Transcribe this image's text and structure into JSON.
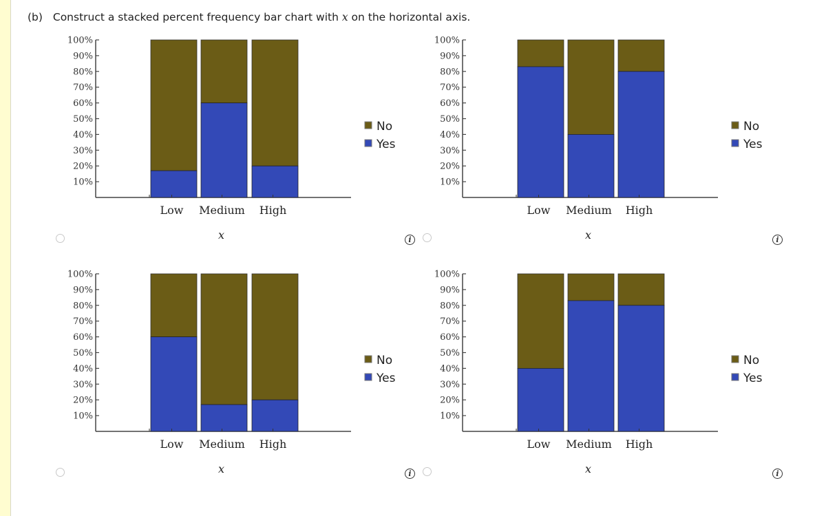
{
  "question": {
    "part": "(b)",
    "text_before": "Construct a stacked percent frequency bar chart with ",
    "variable": "x",
    "text_after": " on the horizontal axis."
  },
  "colors": {
    "No": "#6b5c16",
    "Yes": "#3349b7"
  },
  "options": [
    {
      "id": "option-a",
      "info_icon": "info-icon",
      "radio": "radio-button"
    },
    {
      "id": "option-b",
      "info_icon": "info-icon",
      "radio": "radio-button"
    },
    {
      "id": "option-c",
      "info_icon": "info-icon",
      "radio": "radio-button"
    },
    {
      "id": "option-d",
      "info_icon": "info-icon",
      "radio": "radio-button"
    }
  ],
  "info_glyph": "i",
  "chart_data": [
    {
      "type": "bar",
      "stacked": true,
      "categories": [
        "Low",
        "Medium",
        "High"
      ],
      "series": [
        {
          "name": "Yes",
          "values": [
            17,
            60,
            20
          ]
        },
        {
          "name": "No",
          "values": [
            83,
            40,
            80
          ]
        }
      ],
      "xlabel": "x",
      "ylabel": "",
      "yticks": [
        "10%",
        "20%",
        "30%",
        "40%",
        "50%",
        "60%",
        "70%",
        "80%",
        "90%",
        "100%"
      ],
      "ylim": [
        0,
        100
      ],
      "legend": [
        "No",
        "Yes"
      ],
      "legend_position": "right",
      "grid": false
    },
    {
      "type": "bar",
      "stacked": true,
      "categories": [
        "Low",
        "Medium",
        "High"
      ],
      "series": [
        {
          "name": "Yes",
          "values": [
            83,
            40,
            80
          ]
        },
        {
          "name": "No",
          "values": [
            17,
            60,
            20
          ]
        }
      ],
      "xlabel": "x",
      "ylabel": "",
      "yticks": [
        "10%",
        "20%",
        "30%",
        "40%",
        "50%",
        "60%",
        "70%",
        "80%",
        "90%",
        "100%"
      ],
      "ylim": [
        0,
        100
      ],
      "legend": [
        "No",
        "Yes"
      ],
      "legend_position": "right",
      "grid": false
    },
    {
      "type": "bar",
      "stacked": true,
      "categories": [
        "Low",
        "Medium",
        "High"
      ],
      "series": [
        {
          "name": "Yes",
          "values": [
            60,
            17,
            20
          ]
        },
        {
          "name": "No",
          "values": [
            40,
            83,
            80
          ]
        }
      ],
      "xlabel": "x",
      "ylabel": "",
      "yticks": [
        "10%",
        "20%",
        "30%",
        "40%",
        "50%",
        "60%",
        "70%",
        "80%",
        "90%",
        "100%"
      ],
      "ylim": [
        0,
        100
      ],
      "legend": [
        "No",
        "Yes"
      ],
      "legend_position": "right",
      "grid": false
    },
    {
      "type": "bar",
      "stacked": true,
      "categories": [
        "Low",
        "Medium",
        "High"
      ],
      "series": [
        {
          "name": "Yes",
          "values": [
            40,
            83,
            80
          ]
        },
        {
          "name": "No",
          "values": [
            60,
            17,
            20
          ]
        }
      ],
      "xlabel": "x",
      "ylabel": "",
      "yticks": [
        "10%",
        "20%",
        "30%",
        "40%",
        "50%",
        "60%",
        "70%",
        "80%",
        "90%",
        "100%"
      ],
      "ylim": [
        0,
        100
      ],
      "legend": [
        "No",
        "Yes"
      ],
      "legend_position": "right",
      "grid": false
    }
  ]
}
